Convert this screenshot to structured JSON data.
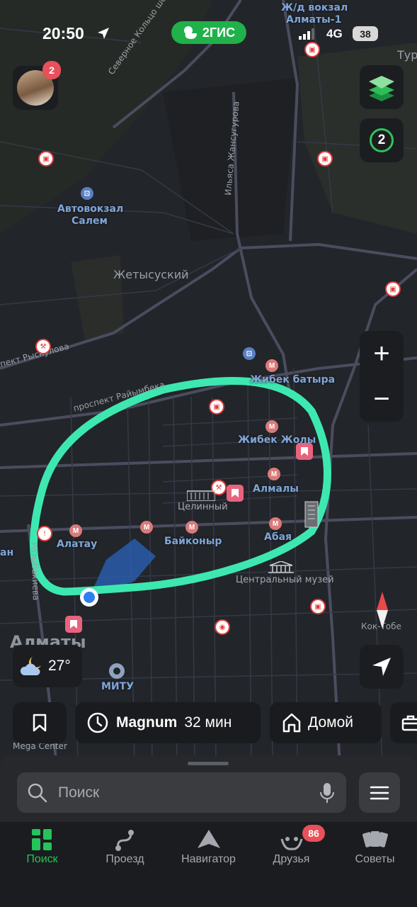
{
  "status_bar": {
    "time": "20:50",
    "app_badge": "2ГИС",
    "network": "4G",
    "battery": "38"
  },
  "profile": {
    "badge_count": "2"
  },
  "traffic": {
    "level": "2"
  },
  "zoom": {
    "plus": "+",
    "minus": "−"
  },
  "map": {
    "labels": {
      "zhd_vokzal": "Ж/д вокзал",
      "almaty1": "Алматы-1",
      "tur": "Тур",
      "avtovokzal": "Автовокзал",
      "salem": "Салем",
      "zhetysu": "Жетысуский",
      "severnoe": "Северное Кольцо шоссе",
      "zhansugurova": "Ильяса Жансугурова",
      "ryskulova": "проспект Рыскулова",
      "raiymbek": "проспект Райымбека",
      "zhibek_batyra": "Жибек батыра",
      "zhibek_zholy": "Жибек Жолы",
      "almaly": "Алмалы",
      "tselinny": "Целинный",
      "alatau": "Алатау",
      "baikonyr": "Байконыр",
      "abaya": "Абая",
      "an": "ан",
      "rozybakieva": "Розыбакиева",
      "central_museum": "Центральный музей",
      "koktobe": "Кок-Тобе",
      "almaty": "Алматы",
      "mitu": "МИТУ",
      "mega_center": "Mega Center"
    }
  },
  "weather": {
    "temperature": "27°"
  },
  "chips": {
    "place": "Magnum",
    "eta": "32 мин",
    "home": "Домой"
  },
  "search": {
    "placeholder": "Поиск"
  },
  "tabs": [
    {
      "label": "Поиск"
    },
    {
      "label": "Проезд"
    },
    {
      "label": "Навигатор"
    },
    {
      "label": "Друзья",
      "badge": "86"
    },
    {
      "label": "Советы"
    }
  ],
  "colors": {
    "accent": "#25c35a",
    "highlight_ring": "#3de8b0",
    "badge": "#e8505b"
  }
}
